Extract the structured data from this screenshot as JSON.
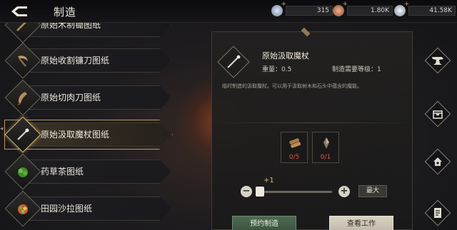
{
  "header": {
    "title": "制造",
    "currencies": [
      {
        "name": "crystal",
        "value": "315",
        "color": "#9aa8c4"
      },
      {
        "name": "copper-coin",
        "value": "1.80K",
        "color": "#c97a52"
      },
      {
        "name": "silver-coin",
        "value": "41.58K",
        "color": "#b9c3cf"
      }
    ]
  },
  "recipe_list": {
    "items": [
      {
        "label": "原始木制锄图纸",
        "icon": "hoe-icon",
        "selected": false
      },
      {
        "label": "原始收割镰刀图纸",
        "icon": "sickle-icon",
        "selected": false
      },
      {
        "label": "原始切肉刀图纸",
        "icon": "cleaver-icon",
        "selected": false
      },
      {
        "label": "原始汲取魔杖图纸",
        "icon": "wand-icon",
        "selected": true
      },
      {
        "label": "药草茶图纸",
        "icon": "herb-tea-icon",
        "selected": false
      },
      {
        "label": "田园沙拉图纸",
        "icon": "salad-icon",
        "selected": false
      }
    ]
  },
  "detail": {
    "name": "原始汲取魔杖",
    "weight_label": "重量：",
    "weight_value": "0.5",
    "level_label": "制造需要等级：",
    "level_value": "1",
    "description": "临时制造的汲取魔杖。可以用于汲取树木和石头中蕴含的魔能。",
    "materials": [
      {
        "icon": "wood-icon",
        "count": "0/5"
      },
      {
        "icon": "crystal-shard-icon",
        "count": "0/1"
      }
    ],
    "quantity_increment": "+1",
    "quantity_fraction": 0.05,
    "max_label": "最大",
    "reserve_label": "预约制造",
    "view_label": "查看工作"
  },
  "side_menu": [
    {
      "icon": "anvil-icon"
    },
    {
      "icon": "box-icon"
    },
    {
      "icon": "house-icon"
    },
    {
      "icon": "document-icon"
    }
  ]
}
